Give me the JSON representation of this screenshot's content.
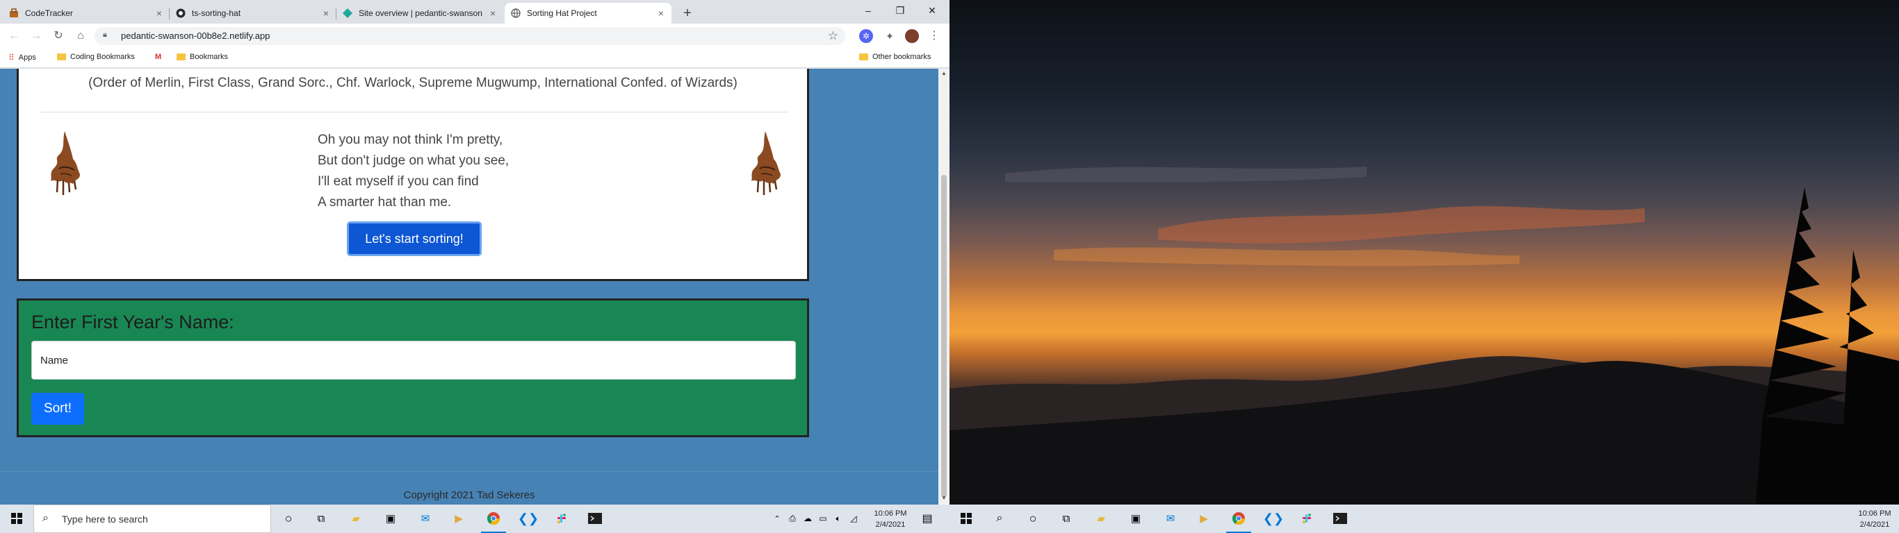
{
  "browser": {
    "tabs": [
      {
        "title": "CodeTracker",
        "icon": "codetracker-icon"
      },
      {
        "title": "ts-sorting-hat",
        "icon": "github-icon"
      },
      {
        "title": "Site overview | pedantic-swanson",
        "icon": "netlify-icon"
      },
      {
        "title": "Sorting Hat Project",
        "icon": "globe-icon",
        "active": true
      }
    ],
    "url": "pedantic-swanson-00b8e2.netlify.app",
    "bookmarks": {
      "apps": "Apps",
      "coding": "Coding Bookmarks",
      "gmail": "M",
      "bookmarks": "Bookmarks",
      "other": "Other bookmarks"
    }
  },
  "page": {
    "titles_line": "(Order of Merlin, First Class, Grand Sorc., Chf. Warlock, Supreme Mugwump, International Confed. of Wizards)",
    "poem": [
      "Oh you may not think I'm pretty,",
      "But don't judge on what you see,",
      "I'll eat myself if you can find",
      "A smarter hat than me."
    ],
    "start_button": "Let's start sorting!",
    "form": {
      "title": "Enter First Year's Name:",
      "placeholder": "Name",
      "sort_button": "Sort!"
    },
    "copyright": "Copyright 2021 Tad Sekeres",
    "colors": {
      "background": "#4682b4",
      "form_card": "#198754",
      "primary_button": "#0d6efd"
    }
  },
  "taskbar_left": {
    "search_placeholder": "Type here to search",
    "time": "10:06 PM",
    "date": "2/4/2021"
  },
  "taskbar_right": {
    "time": "10:06 PM",
    "date": "2/4/2021"
  }
}
